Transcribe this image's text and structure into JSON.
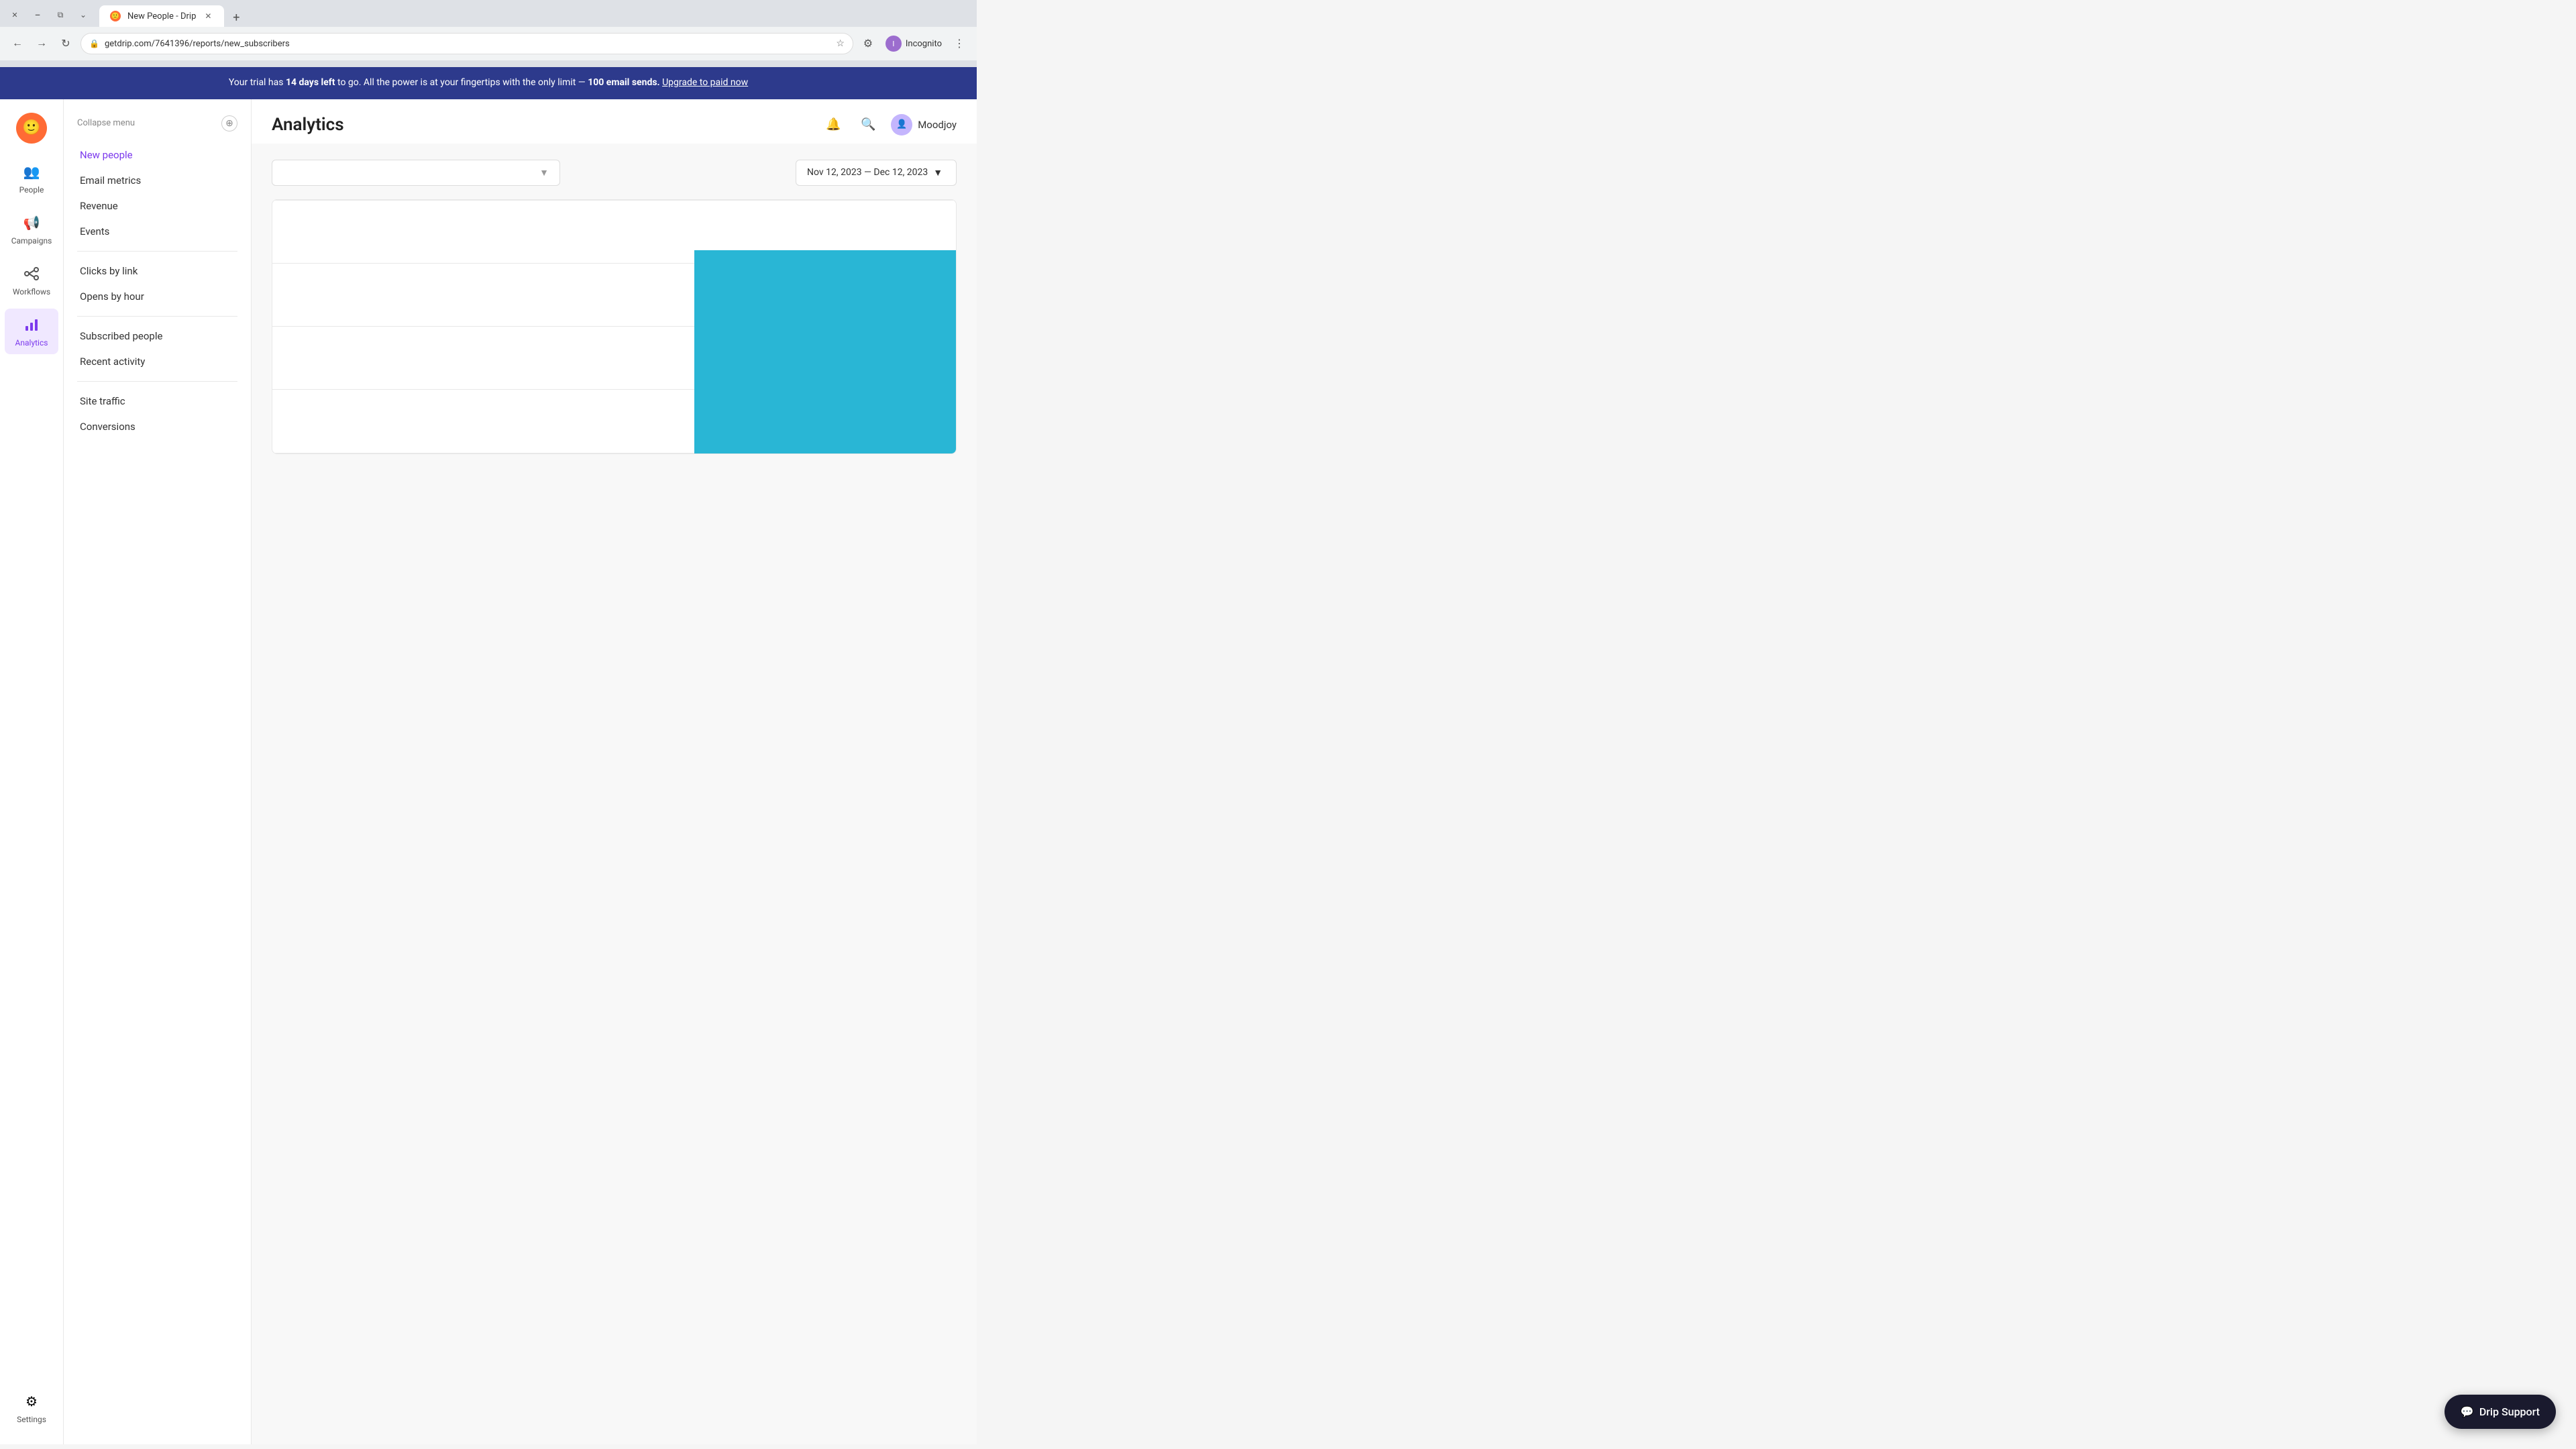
{
  "browser": {
    "tab_title": "New People - Drip",
    "tab_favicon": "🙂",
    "new_tab_icon": "+",
    "url": "getdrip.com/7641396/reports/new_subscribers",
    "url_full": "getdrip.com/7641396/reports/new_subscribers",
    "profile_name": "Incognito",
    "nav_back": "←",
    "nav_forward": "→",
    "nav_refresh": "↻",
    "win_minimize": "−",
    "win_restore": "⧉",
    "win_close": "✕",
    "win_chevron": "⌄"
  },
  "trial_banner": {
    "text_before": "Your trial has ",
    "days": "14 days left",
    "text_middle": " to go. All the power is at your fingertips with the only limit — ",
    "limit": "100 email sends.",
    "upgrade_text": "Upgrade to paid now"
  },
  "sidebar": {
    "collapse_label": "Collapse menu",
    "collapse_icon": "⊕",
    "menu_items": [
      {
        "label": "New people",
        "active": true,
        "id": "new-people"
      },
      {
        "label": "Email metrics",
        "active": false,
        "id": "email-metrics"
      },
      {
        "label": "Revenue",
        "active": false,
        "id": "revenue"
      },
      {
        "label": "Events",
        "active": false,
        "id": "events"
      },
      {
        "label": "Clicks by link",
        "active": false,
        "id": "clicks-by-link"
      },
      {
        "label": "Opens by hour",
        "active": false,
        "id": "opens-by-hour"
      },
      {
        "label": "Subscribed people",
        "active": false,
        "id": "subscribed-people"
      },
      {
        "label": "Recent activity",
        "active": false,
        "id": "recent-activity"
      },
      {
        "label": "Site traffic",
        "active": false,
        "id": "site-traffic"
      },
      {
        "label": "Conversions",
        "active": false,
        "id": "conversions"
      }
    ]
  },
  "nav": {
    "logo_icon": "🙂",
    "items": [
      {
        "label": "People",
        "icon": "👥",
        "id": "people",
        "active": false
      },
      {
        "label": "Campaigns",
        "icon": "📢",
        "id": "campaigns",
        "active": false
      },
      {
        "label": "Workflows",
        "icon": "⚡",
        "id": "workflows",
        "active": false
      },
      {
        "label": "Analytics",
        "icon": "📊",
        "id": "analytics",
        "active": true
      },
      {
        "label": "Settings",
        "icon": "⚙",
        "id": "settings",
        "active": false
      }
    ]
  },
  "header": {
    "title": "Analytics",
    "notification_icon": "🔔",
    "search_icon": "🔍",
    "user_icon": "👤",
    "username": "Moodjoy"
  },
  "chart": {
    "date_range": "Nov 12, 2023 — Dec 12, 2023",
    "date_range_icon": "▼",
    "segment_placeholder": "",
    "segment_icon": "▼"
  },
  "support": {
    "button_label": "Drip Support",
    "chat_icon": "💬"
  }
}
